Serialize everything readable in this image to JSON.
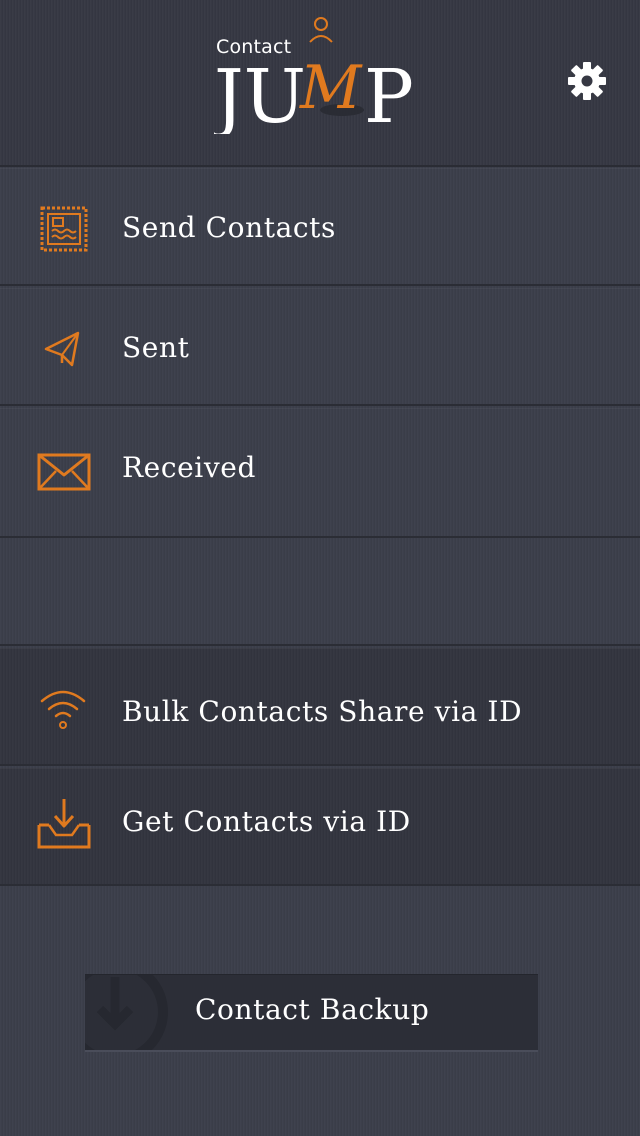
{
  "header": {
    "logo_small": "Contact",
    "logo_big_prefix": "JU",
    "logo_big_m": "M",
    "logo_big_suffix": "P",
    "settings_icon": "gear-icon"
  },
  "menu": {
    "items": [
      {
        "label": "Send Contacts",
        "icon": "stamp-icon"
      },
      {
        "label": "Sent",
        "icon": "paper-plane-icon"
      },
      {
        "label": "Received",
        "icon": "envelope-icon"
      }
    ],
    "id_items": [
      {
        "label": "Bulk Contacts Share via ID",
        "icon": "wifi-icon"
      },
      {
        "label": "Get Contacts via ID",
        "icon": "download-tray-icon"
      }
    ]
  },
  "backup": {
    "label": "Contact Backup",
    "icon": "backup-icon"
  },
  "colors": {
    "accent": "#e07a1f",
    "background": "#3b3e4a",
    "text": "#ffffff"
  }
}
